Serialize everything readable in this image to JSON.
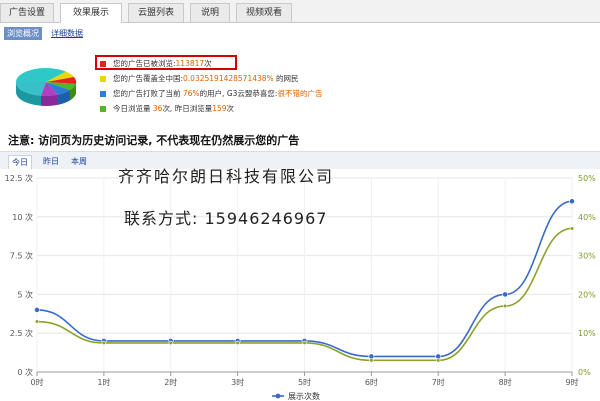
{
  "tabs": [
    {
      "label": "广告设置",
      "active": false
    },
    {
      "label": "效果展示",
      "active": true
    },
    {
      "label": "云盟列表",
      "active": false
    },
    {
      "label": "说明",
      "active": false
    },
    {
      "label": "视频观看",
      "active": false
    }
  ],
  "subtabs": {
    "overview": "浏览概况",
    "details": "详细数据"
  },
  "stats": {
    "line1_prefix": "您的广告已被浏览:",
    "line1_value": "113817",
    "line1_suffix": "次",
    "line2_prefix": "您的广告覆盖全中国:",
    "line2_value": "0.0325191428571438%",
    "line2_suffix": " 的网民",
    "line3_prefix": "您的广告打败了当前 ",
    "line3_value": "76%",
    "line3_mid": "的用户, G3云盟恭喜您:",
    "line3_value2": "很不错的广告",
    "line4_prefix": "今日浏览量 ",
    "line4_value": "36",
    "line4_mid": "次, 昨日浏览量",
    "line4_value2": "159",
    "line4_suffix": "次"
  },
  "colors": {
    "red": "#e82020",
    "yellow": "#e8d800",
    "blue": "#2a7fd4",
    "green": "#55b52a",
    "highlight": "#e06000",
    "series1": "#3a6bc9",
    "series2": "#8aa22a"
  },
  "notice": "注意: 访问页为历史访问记录, 不代表现在仍然展示您的广告",
  "day_tabs": [
    {
      "label": "今日",
      "active": true
    },
    {
      "label": "昨日",
      "active": false
    },
    {
      "label": "本周",
      "active": false
    }
  ],
  "overlay": {
    "company": "齐齐哈尔朗日科技有限公司",
    "contact": "联系方式: 15946246967"
  },
  "chart_data": {
    "type": "line",
    "categories": [
      "0时",
      "1时",
      "2时",
      "3时",
      "5时",
      "6时",
      "7时",
      "8时",
      "9时"
    ],
    "y_ticks_left": [
      "0 次",
      "2.5 次",
      "5 次",
      "7.5 次",
      "10 次",
      "12.5 次"
    ],
    "y_ticks_right": [
      "0%",
      "10%",
      "20%",
      "30%",
      "40%",
      "50%"
    ],
    "ylim": [
      0,
      12.5
    ],
    "y2lim": [
      0,
      50
    ],
    "grid": true,
    "legend_position": "bottom",
    "series": [
      {
        "name": "展示次数",
        "values": [
          4,
          2,
          2,
          2,
          2,
          1,
          1,
          5,
          11
        ],
        "axis": "left"
      },
      {
        "values": [
          13,
          7.5,
          7.5,
          7.5,
          7.5,
          3,
          3,
          17,
          37
        ],
        "axis": "right"
      }
    ]
  }
}
